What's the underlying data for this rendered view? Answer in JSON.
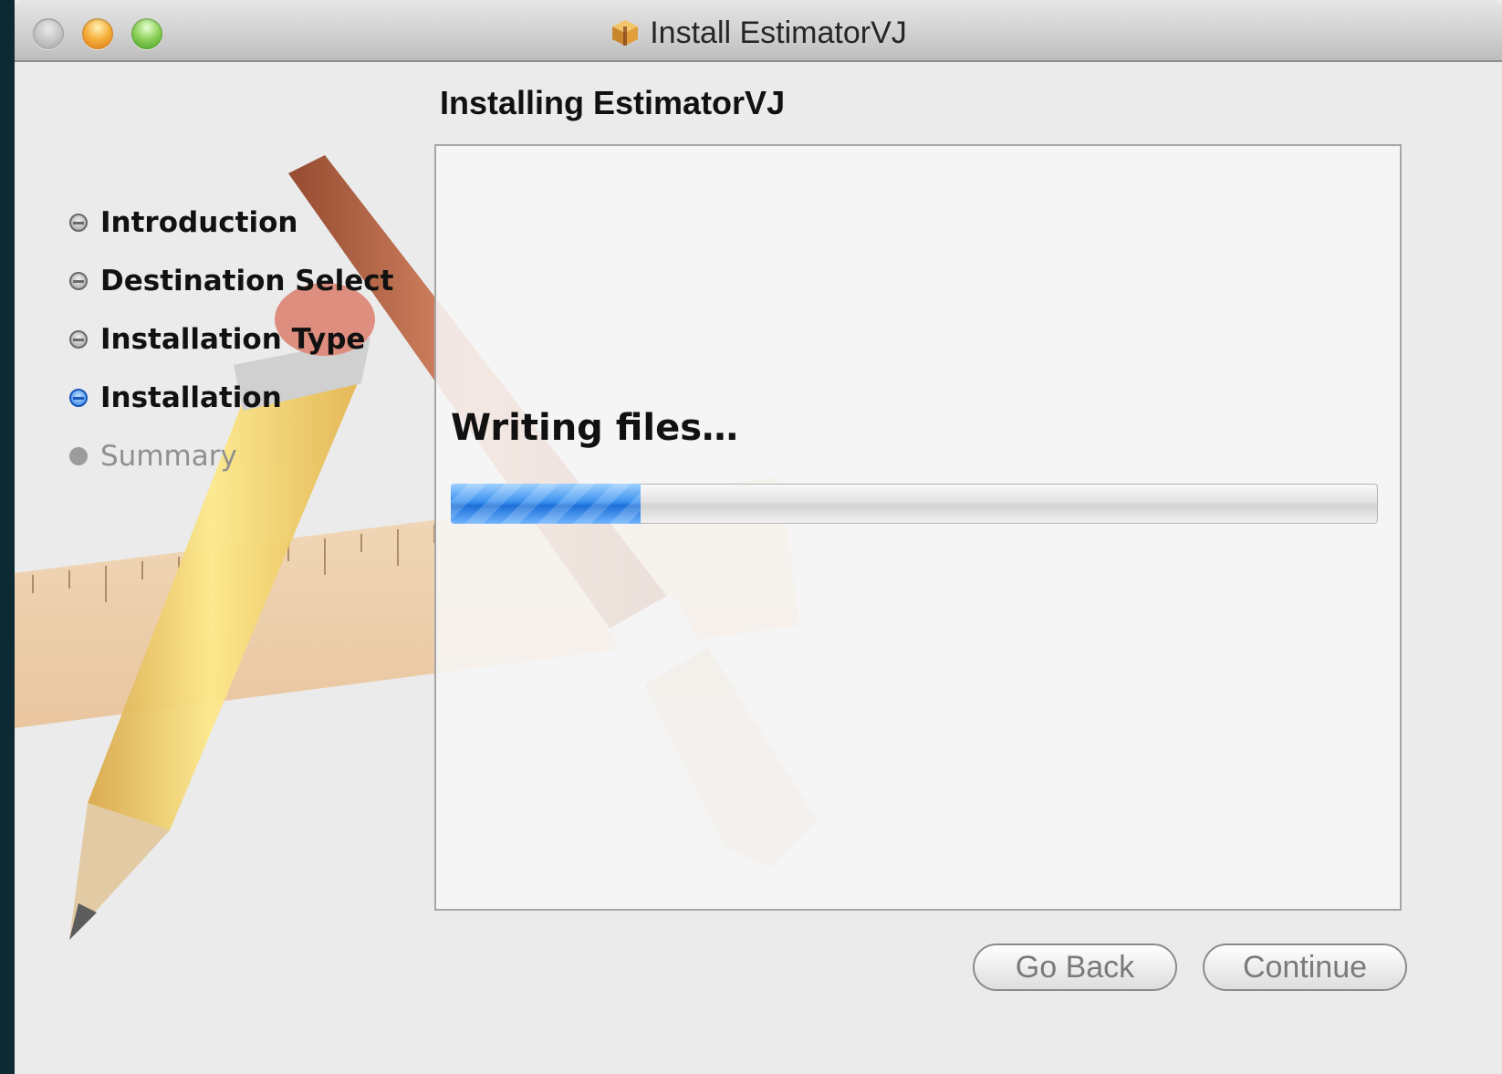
{
  "window": {
    "title": "Install EstimatorVJ",
    "app_icon": "package-icon"
  },
  "content": {
    "heading": "Installing EstimatorVJ",
    "status": "Writing files…",
    "progress": 0.205
  },
  "steps": [
    {
      "label": "Introduction",
      "state": "done"
    },
    {
      "label": "Destination Select",
      "state": "done"
    },
    {
      "label": "Installation Type",
      "state": "done"
    },
    {
      "label": "Installation",
      "state": "active"
    },
    {
      "label": "Summary",
      "state": "pending"
    }
  ],
  "buttons": {
    "go_back": "Go Back",
    "continue": "Continue"
  },
  "colors": {
    "accent": "#2b7ee8",
    "background": "#ebebeb"
  }
}
